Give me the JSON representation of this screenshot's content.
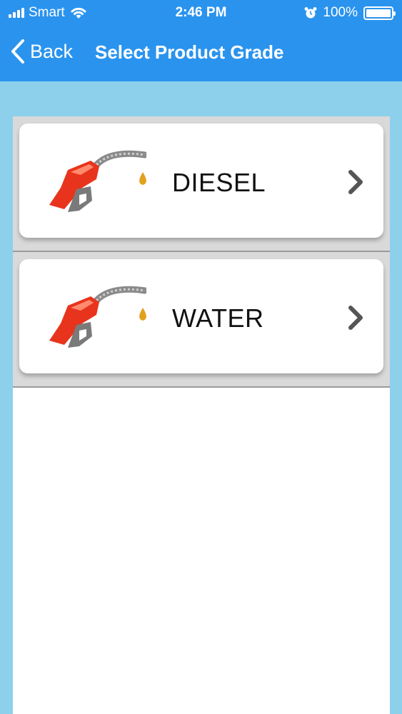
{
  "status_bar": {
    "carrier": "Smart",
    "time": "2:46 PM",
    "battery_text": "100%"
  },
  "nav": {
    "back_label": "Back",
    "title": "Select Product Grade"
  },
  "products": [
    {
      "label": "DIESEL",
      "icon": "fuel-nozzle-icon"
    },
    {
      "label": "WATER",
      "icon": "fuel-nozzle-icon"
    }
  ],
  "colors": {
    "nav_bar": "#2a93ee",
    "background": "#8dd0ec",
    "nozzle": "#e8341c"
  }
}
